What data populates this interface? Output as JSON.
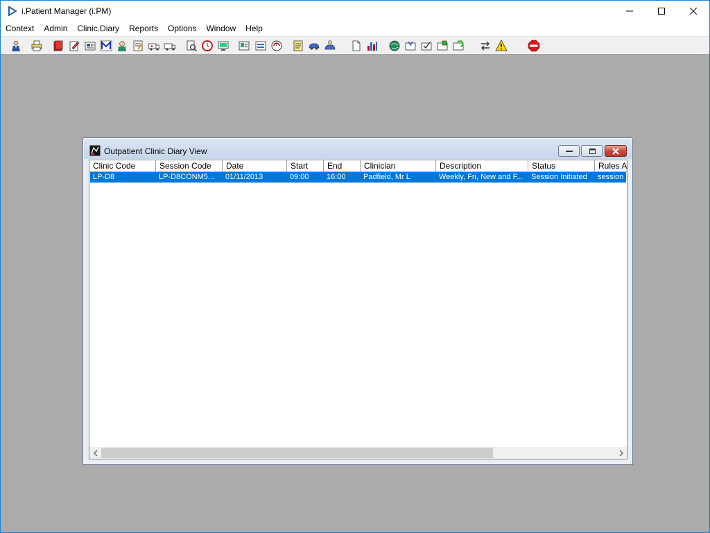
{
  "app": {
    "title": "i.Patient Manager (i.PM)"
  },
  "menu": [
    "Context",
    "Admin",
    "Clinic.Diary",
    "Reports",
    "Options",
    "Window",
    "Help"
  ],
  "toolbar_icons": [
    "patient-icon",
    "printer-icon",
    "book-red-icon",
    "edit-document-icon",
    "newspaper-icon",
    "m-logo-icon",
    "nurse-icon",
    "notepad-icon",
    "ambulance-icon",
    "ambulance-2-icon",
    "scan-document-icon",
    "clock-icon",
    "monitor-icon",
    "id-card-icon",
    "ward-icon",
    "refresh-circle-icon",
    "notes-icon",
    "car-icon",
    "person-car-icon",
    "blank-document-icon",
    "bar-chart-icon",
    "globe-icon",
    "inbox-down-icon",
    "inbox-check-icon",
    "inbox-green-icon",
    "inbox-refresh-icon",
    "transfer-arrows-icon",
    "warning-icon",
    "exit-icon"
  ],
  "child_window": {
    "title": "Outpatient Clinic Diary View",
    "columns": [
      "Clinic Code",
      "Session Code",
      "Date",
      "Start",
      "End",
      "Clinician",
      "Description",
      "Status",
      "Rules Ap"
    ],
    "rows": [
      [
        "LP-D8",
        "LP-D8CONM5...",
        "01/11/2013",
        "09:00",
        "16:00",
        "Padfield, Mr L",
        "Weekly, Fri, New and F...",
        "Session Initiated",
        "session"
      ]
    ],
    "selected_row": 0
  },
  "colors": {
    "selection": "#0078d7",
    "workspace": "#ababab",
    "app_border": "#1883d7"
  }
}
